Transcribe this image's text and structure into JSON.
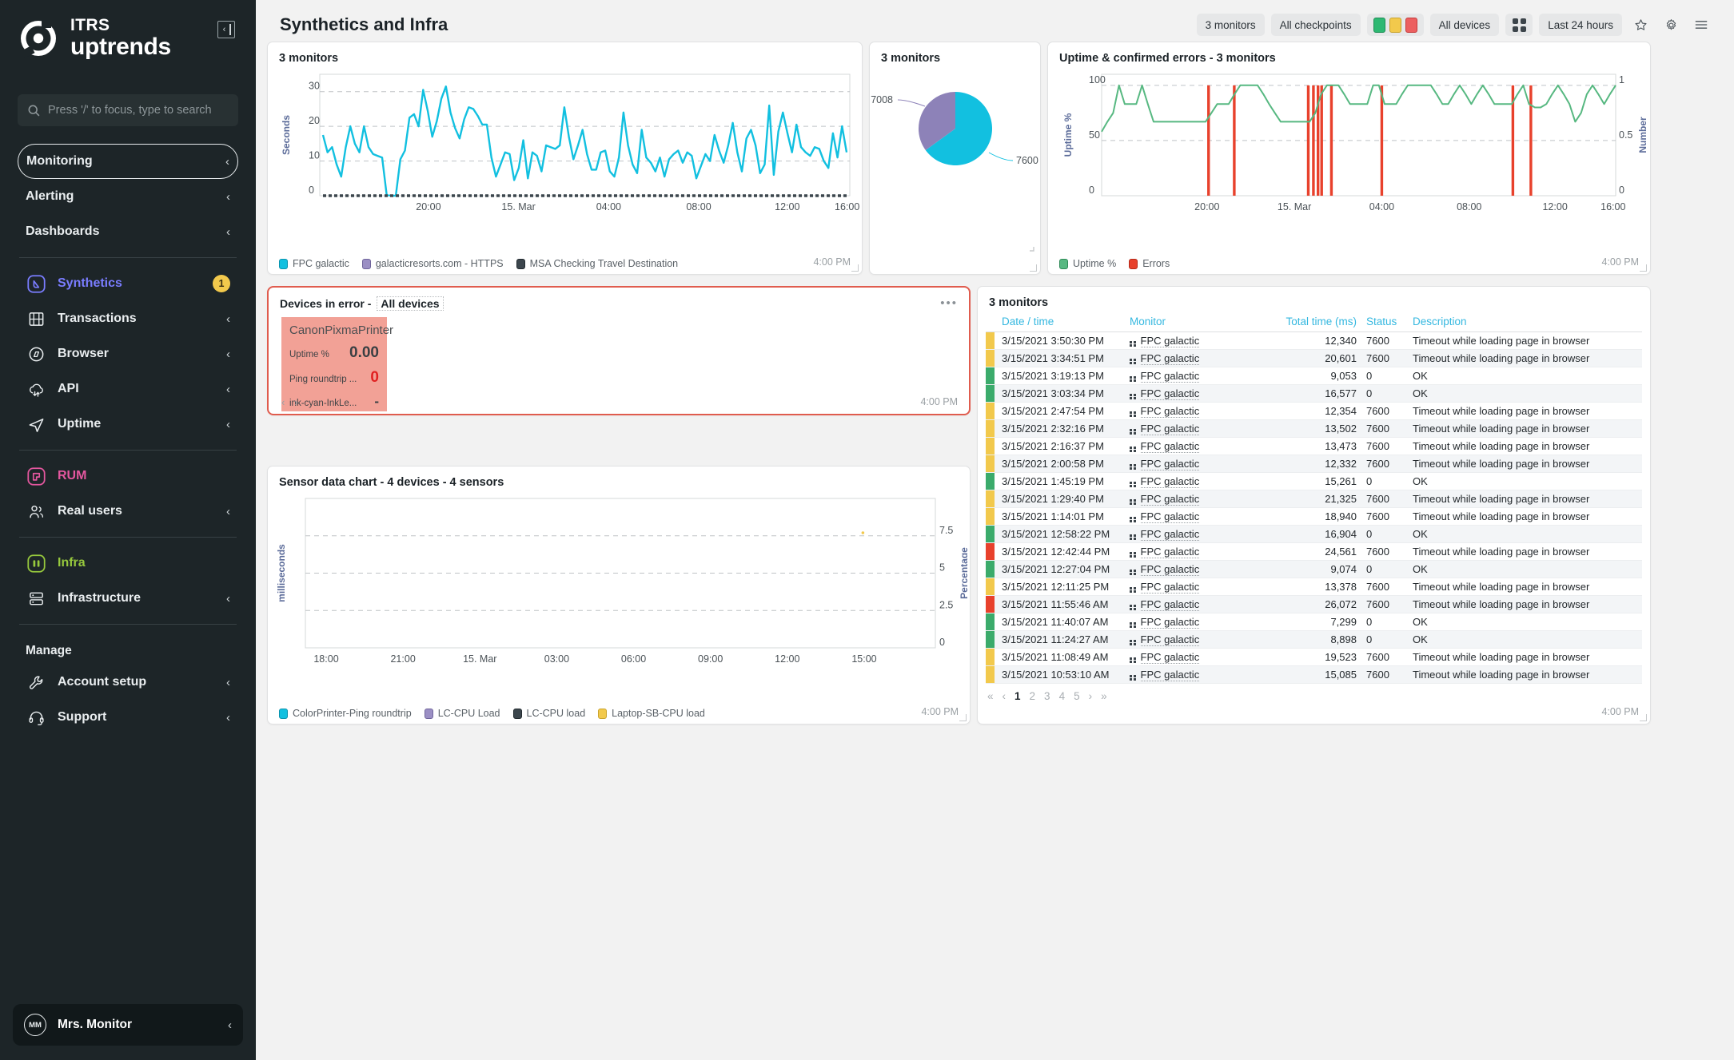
{
  "brand": {
    "line1": "ITRS",
    "line2": "uptrends"
  },
  "search": {
    "placeholder": "Press '/' to focus, type to search"
  },
  "sidebar": {
    "primary": [
      {
        "label": "Monitoring",
        "chev": "‹"
      },
      {
        "label": "Alerting",
        "chev": "‹"
      },
      {
        "label": "Dashboards",
        "chev": "‹"
      }
    ],
    "synthetics_group": [
      {
        "label": "Synthetics",
        "icon": "synthetics-icon",
        "badge": "1"
      },
      {
        "label": "Transactions",
        "icon": "transactions-icon",
        "chev": "‹"
      },
      {
        "label": "Browser",
        "icon": "browser-icon",
        "chev": "‹"
      },
      {
        "label": "API",
        "icon": "api-icon",
        "chev": "‹"
      },
      {
        "label": "Uptime",
        "icon": "uptime-icon",
        "chev": "‹"
      }
    ],
    "rum_group": [
      {
        "label": "RUM",
        "icon": "rum-icon"
      },
      {
        "label": "Real users",
        "icon": "real-users-icon",
        "chev": "‹"
      }
    ],
    "infra_group": [
      {
        "label": "Infra",
        "icon": "infra-icon"
      },
      {
        "label": "Infrastructure",
        "icon": "infrastructure-icon",
        "chev": "‹"
      }
    ],
    "manage_title": "Manage",
    "manage_group": [
      {
        "label": "Account setup",
        "icon": "wrench-icon",
        "chev": "‹"
      },
      {
        "label": "Support",
        "icon": "headset-icon",
        "chev": "‹"
      }
    ],
    "user": {
      "initials": "MM",
      "name": "Mrs. Monitor",
      "chev": "‹"
    }
  },
  "header": {
    "title": "Synthetics and Infra",
    "filters": {
      "monitors": "3 monitors",
      "checkpoints": "All checkpoints",
      "devices": "All devices",
      "timerange": "Last 24 hours"
    },
    "status_colors": {
      "ok": "#2eb872",
      "warn": "#f2c94c",
      "error": "#ec5f5f"
    }
  },
  "panels": {
    "monitors_chart": {
      "title": "3 monitors",
      "time": "4:00 PM"
    },
    "pie": {
      "title": "3 monitors"
    },
    "uptime_errors": {
      "title": "Uptime & confirmed errors - 3 monitors",
      "time": "4:00 PM"
    },
    "devices_in_error": {
      "title": "Devices in error -",
      "subtitle": "All devices",
      "menu": "•••",
      "time": "4:00 PM",
      "device": {
        "name": "CanonPixmaPrinter",
        "rows": [
          {
            "key": "Uptime %",
            "value": "0.00",
            "style": "dark"
          },
          {
            "key": "Ping roundtrip ...",
            "value": "0",
            "style": "red"
          },
          {
            "key": "ink-cyan-InkLe...",
            "value": "-",
            "style": "dash"
          }
        ]
      },
      "prev": "‹",
      "next": "›"
    },
    "sensor_chart": {
      "title": "Sensor data chart - 4 devices - 4 sensors",
      "time": "4:00 PM"
    },
    "table_panel": {
      "title": "3 monitors",
      "time": "4:00 PM"
    }
  },
  "chart_data": [
    {
      "id": "monitors_response_time",
      "type": "line",
      "title": "3 monitors",
      "xlabel": "",
      "ylabel": "Seconds",
      "ylim": [
        0,
        35
      ],
      "yticks": [
        0,
        10,
        20,
        30
      ],
      "xticks": [
        "20:00",
        "15. Mar",
        "04:00",
        "08:00",
        "12:00",
        "16:00"
      ],
      "grid": true,
      "legend_position": "bottom",
      "series": [
        {
          "name": "FPC galactic",
          "color": "#12c0e0",
          "values": [
            17.5,
            12.5,
            14.0,
            9.0,
            5.5,
            14.0,
            20.0,
            15.0,
            12.5,
            20.0,
            14.0,
            12.0,
            11.5,
            11.0,
            0.2,
            0.0,
            0.0,
            10.5,
            13.0,
            22.5,
            23.5,
            20.0,
            30.5,
            24.5,
            17.0,
            21.5,
            28.0,
            31.5,
            24.0,
            19.5,
            16.5,
            22.0,
            25.5,
            25.0,
            23.0,
            20.5,
            20.5,
            11.0,
            5.5,
            9.0,
            12.5,
            12.0,
            4.5,
            8.0,
            16.0,
            5.0,
            12.5,
            11.5,
            7.0,
            14.5,
            14.0,
            13.5,
            14.5,
            25.5,
            17.0,
            10.5,
            14.5,
            19.0,
            12.0,
            7.5,
            7.5,
            12.5,
            13.0,
            7.0,
            5.5,
            11.0,
            24.0,
            14.5,
            9.0,
            6.5,
            19.0,
            11.0,
            9.5,
            7.0,
            11.0,
            5.5,
            10.5,
            12.0,
            13.0,
            9.5,
            12.5,
            11.5,
            5.0,
            8.5,
            12.0,
            10.0,
            17.5,
            13.0,
            9.5,
            14.5,
            21.0,
            12.5,
            7.0,
            16.5,
            19.0,
            14.5,
            6.5,
            9.0,
            26.0,
            6.0,
            18.5,
            24.0,
            18.0,
            12.5,
            20.5,
            14.0,
            12.5,
            11.5,
            14.0,
            13.5,
            10.0,
            8.0,
            18.0,
            11.0,
            20.0,
            12.5
          ]
        },
        {
          "name": "galacticresorts.com - HTTPS",
          "color": "#9b8fc4",
          "values": []
        },
        {
          "name": "MSA Checking Travel Destination",
          "color": "#3c464d",
          "values": []
        }
      ]
    },
    {
      "id": "monitors_pie",
      "type": "pie",
      "title": "3 monitors",
      "labels": [
        "7600",
        "7008"
      ],
      "values": [
        65,
        35
      ],
      "colors": [
        "#12c0e0",
        "#8d82b8"
      ]
    },
    {
      "id": "uptime_confirmed_errors",
      "type": "line",
      "title": "Uptime & confirmed errors - 3 monitors",
      "ylabel": "Uptime %",
      "ylabel_right": "Number",
      "ylim": [
        0,
        110
      ],
      "yticks": [
        0,
        50,
        100
      ],
      "yticks_right": [
        0,
        0.5,
        1
      ],
      "xticks": [
        "20:00",
        "15. Mar",
        "04:00",
        "08:00",
        "12:00",
        "16:00"
      ],
      "grid": true,
      "legend_position": "bottom",
      "series": [
        {
          "name": "Uptime %",
          "color": "#57b881",
          "values": [
            58,
            67,
            75,
            100,
            83,
            83,
            83,
            100,
            83,
            67,
            67,
            67,
            67,
            67,
            67,
            67,
            67,
            67,
            67,
            75,
            83,
            83,
            83,
            92,
            100,
            100,
            100,
            100,
            92,
            83,
            75,
            67,
            67,
            67,
            67,
            67,
            67,
            75,
            92,
            100,
            100,
            100,
            92,
            83,
            83,
            83,
            83,
            100,
            100,
            83,
            83,
            83,
            92,
            100,
            100,
            100,
            100,
            100,
            92,
            83,
            83,
            92,
            100,
            92,
            83,
            92,
            100,
            92,
            83,
            83,
            83,
            83,
            92,
            100,
            83,
            80,
            80,
            83,
            92,
            100,
            92,
            83,
            67,
            75,
            92,
            100,
            92,
            83,
            92,
            100
          ]
        },
        {
          "name": "Errors",
          "color": "#e8412c",
          "error_positions": [
            0.208,
            0.258,
            0.402,
            0.412,
            0.421,
            0.428,
            0.447,
            0.545,
            0.8,
            0.835
          ]
        }
      ]
    },
    {
      "id": "sensor_data_chart",
      "type": "line",
      "title": "Sensor data chart - 4 devices - 4 sensors",
      "ylabel": "milliseconds",
      "ylabel_right": "Percentage",
      "yticks_right": [
        0,
        2.5,
        5,
        7.5
      ],
      "xticks": [
        "18:00",
        "21:00",
        "15. Mar",
        "03:00",
        "06:00",
        "09:00",
        "12:00",
        "15:00"
      ],
      "grid": true,
      "legend_position": "bottom",
      "series": [
        {
          "name": "ColorPrinter-Ping roundtrip",
          "color": "#12c0e0",
          "values": []
        },
        {
          "name": "LC-CPU Load",
          "color": "#9b8fc4",
          "values": []
        },
        {
          "name": "LC-CPU load",
          "color": "#3c464d",
          "values": []
        },
        {
          "name": "Laptop-SB-CPU load",
          "color": "#f2c94c",
          "values": [
            {
              "x": 0.885,
              "y": 7.7
            }
          ]
        }
      ]
    }
  ],
  "table": {
    "columns": [
      "Date / time",
      "Monitor",
      "Total time (ms)",
      "Status",
      "Description"
    ],
    "rows": [
      {
        "status": "#f2c94c",
        "datetime": "3/15/2021 3:50:30 PM",
        "monitor": "FPC galactic",
        "total": "12,340",
        "code": "7600",
        "desc": "Timeout while loading page in browser"
      },
      {
        "status": "#f2c94c",
        "datetime": "3/15/2021 3:34:51 PM",
        "monitor": "FPC galactic",
        "total": "20,601",
        "code": "7600",
        "desc": "Timeout while loading page in browser"
      },
      {
        "status": "#3bab6b",
        "datetime": "3/15/2021 3:19:13 PM",
        "monitor": "FPC galactic",
        "total": "9,053",
        "code": "0",
        "desc": "OK"
      },
      {
        "status": "#3bab6b",
        "datetime": "3/15/2021 3:03:34 PM",
        "monitor": "FPC galactic",
        "total": "16,577",
        "code": "0",
        "desc": "OK"
      },
      {
        "status": "#f2c94c",
        "datetime": "3/15/2021 2:47:54 PM",
        "monitor": "FPC galactic",
        "total": "12,354",
        "code": "7600",
        "desc": "Timeout while loading page in browser"
      },
      {
        "status": "#f2c94c",
        "datetime": "3/15/2021 2:32:16 PM",
        "monitor": "FPC galactic",
        "total": "13,502",
        "code": "7600",
        "desc": "Timeout while loading page in browser"
      },
      {
        "status": "#f2c94c",
        "datetime": "3/15/2021 2:16:37 PM",
        "monitor": "FPC galactic",
        "total": "13,473",
        "code": "7600",
        "desc": "Timeout while loading page in browser"
      },
      {
        "status": "#f2c94c",
        "datetime": "3/15/2021 2:00:58 PM",
        "monitor": "FPC galactic",
        "total": "12,332",
        "code": "7600",
        "desc": "Timeout while loading page in browser"
      },
      {
        "status": "#3bab6b",
        "datetime": "3/15/2021 1:45:19 PM",
        "monitor": "FPC galactic",
        "total": "15,261",
        "code": "0",
        "desc": "OK"
      },
      {
        "status": "#f2c94c",
        "datetime": "3/15/2021 1:29:40 PM",
        "monitor": "FPC galactic",
        "total": "21,325",
        "code": "7600",
        "desc": "Timeout while loading page in browser"
      },
      {
        "status": "#f2c94c",
        "datetime": "3/15/2021 1:14:01 PM",
        "monitor": "FPC galactic",
        "total": "18,940",
        "code": "7600",
        "desc": "Timeout while loading page in browser"
      },
      {
        "status": "#3bab6b",
        "datetime": "3/15/2021 12:58:22 PM",
        "monitor": "FPC galactic",
        "total": "16,904",
        "code": "0",
        "desc": "OK"
      },
      {
        "status": "#e8412c",
        "datetime": "3/15/2021 12:42:44 PM",
        "monitor": "FPC galactic",
        "total": "24,561",
        "code": "7600",
        "desc": "Timeout while loading page in browser"
      },
      {
        "status": "#3bab6b",
        "datetime": "3/15/2021 12:27:04 PM",
        "monitor": "FPC galactic",
        "total": "9,074",
        "code": "0",
        "desc": "OK"
      },
      {
        "status": "#f2c94c",
        "datetime": "3/15/2021 12:11:25 PM",
        "monitor": "FPC galactic",
        "total": "13,378",
        "code": "7600",
        "desc": "Timeout while loading page in browser"
      },
      {
        "status": "#e8412c",
        "datetime": "3/15/2021 11:55:46 AM",
        "monitor": "FPC galactic",
        "total": "26,072",
        "code": "7600",
        "desc": "Timeout while loading page in browser"
      },
      {
        "status": "#3bab6b",
        "datetime": "3/15/2021 11:40:07 AM",
        "monitor": "FPC galactic",
        "total": "7,299",
        "code": "0",
        "desc": "OK"
      },
      {
        "status": "#3bab6b",
        "datetime": "3/15/2021 11:24:27 AM",
        "monitor": "FPC galactic",
        "total": "8,898",
        "code": "0",
        "desc": "OK"
      },
      {
        "status": "#f2c94c",
        "datetime": "3/15/2021 11:08:49 AM",
        "monitor": "FPC galactic",
        "total": "19,523",
        "code": "7600",
        "desc": "Timeout while loading page in browser"
      },
      {
        "status": "#f2c94c",
        "datetime": "3/15/2021 10:53:10 AM",
        "monitor": "FPC galactic",
        "total": "15,085",
        "code": "7600",
        "desc": "Timeout while loading page in browser"
      }
    ],
    "pagination": {
      "first": "«",
      "prev": "‹",
      "pages": [
        "1",
        "2",
        "3",
        "4",
        "5"
      ],
      "active": "1",
      "next": "›",
      "last": "»"
    }
  }
}
